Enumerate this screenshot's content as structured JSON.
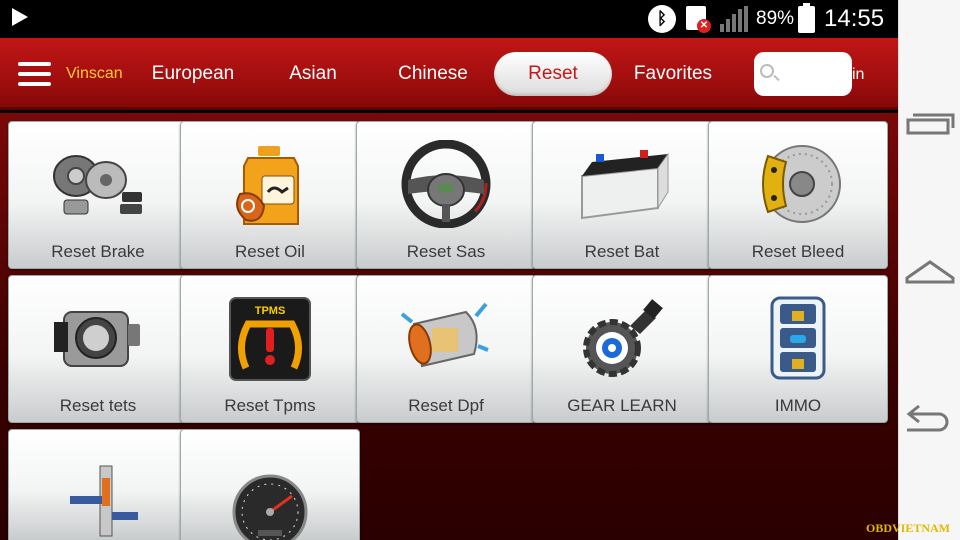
{
  "status_bar": {
    "play_icon": "play-icon",
    "bluetooth_icon": "bluetooth-icon",
    "sim_icon": "sim-error-icon",
    "signal_icon": "signal-icon",
    "battery_percent": "89%",
    "battery_icon": "battery-icon",
    "time": "14:55"
  },
  "header": {
    "menu_icon": "hamburger-menu-icon",
    "brand": "Vinscan",
    "tabs": [
      {
        "label": "European",
        "active": false
      },
      {
        "label": "Asian",
        "active": false
      },
      {
        "label": "Chinese",
        "active": false
      },
      {
        "label": "Reset",
        "active": true
      },
      {
        "label": "Favorites",
        "active": false
      }
    ],
    "search": {
      "placeholder": "",
      "value": "",
      "suffix": "in",
      "icon": "search-icon"
    }
  },
  "tiles": [
    {
      "label": "Reset Brake",
      "icon": "brake-parts-icon"
    },
    {
      "label": "Reset Oil",
      "icon": "oil-can-icon"
    },
    {
      "label": "Reset Sas",
      "icon": "steering-wheel-icon"
    },
    {
      "label": "Reset Bat",
      "icon": "car-battery-icon"
    },
    {
      "label": "Reset Bleed",
      "icon": "brake-caliper-icon"
    },
    {
      "label": "Reset tets",
      "icon": "throttle-body-icon"
    },
    {
      "label": "Reset Tpms",
      "icon": "tpms-warning-icon"
    },
    {
      "label": "Reset Dpf",
      "icon": "dpf-filter-icon"
    },
    {
      "label": "GEAR LEARN",
      "icon": "gear-sensor-icon"
    },
    {
      "label": "IMMO",
      "icon": "immobilizer-lock-icon"
    },
    {
      "label": "",
      "icon": "injector-icon"
    },
    {
      "label": "",
      "icon": "odometer-icon"
    }
  ],
  "tpms_text": "TPMS",
  "nav_bar": {
    "recents_icon": "recent-apps-icon",
    "home_icon": "home-icon",
    "back_icon": "back-icon"
  },
  "watermark": "OBDVIETNAM",
  "colors": {
    "header_red": "#b51212",
    "brand_yellow": "#ffcc33",
    "active_tab_text": "#c01a1a",
    "content_bg": "#5a0404"
  }
}
